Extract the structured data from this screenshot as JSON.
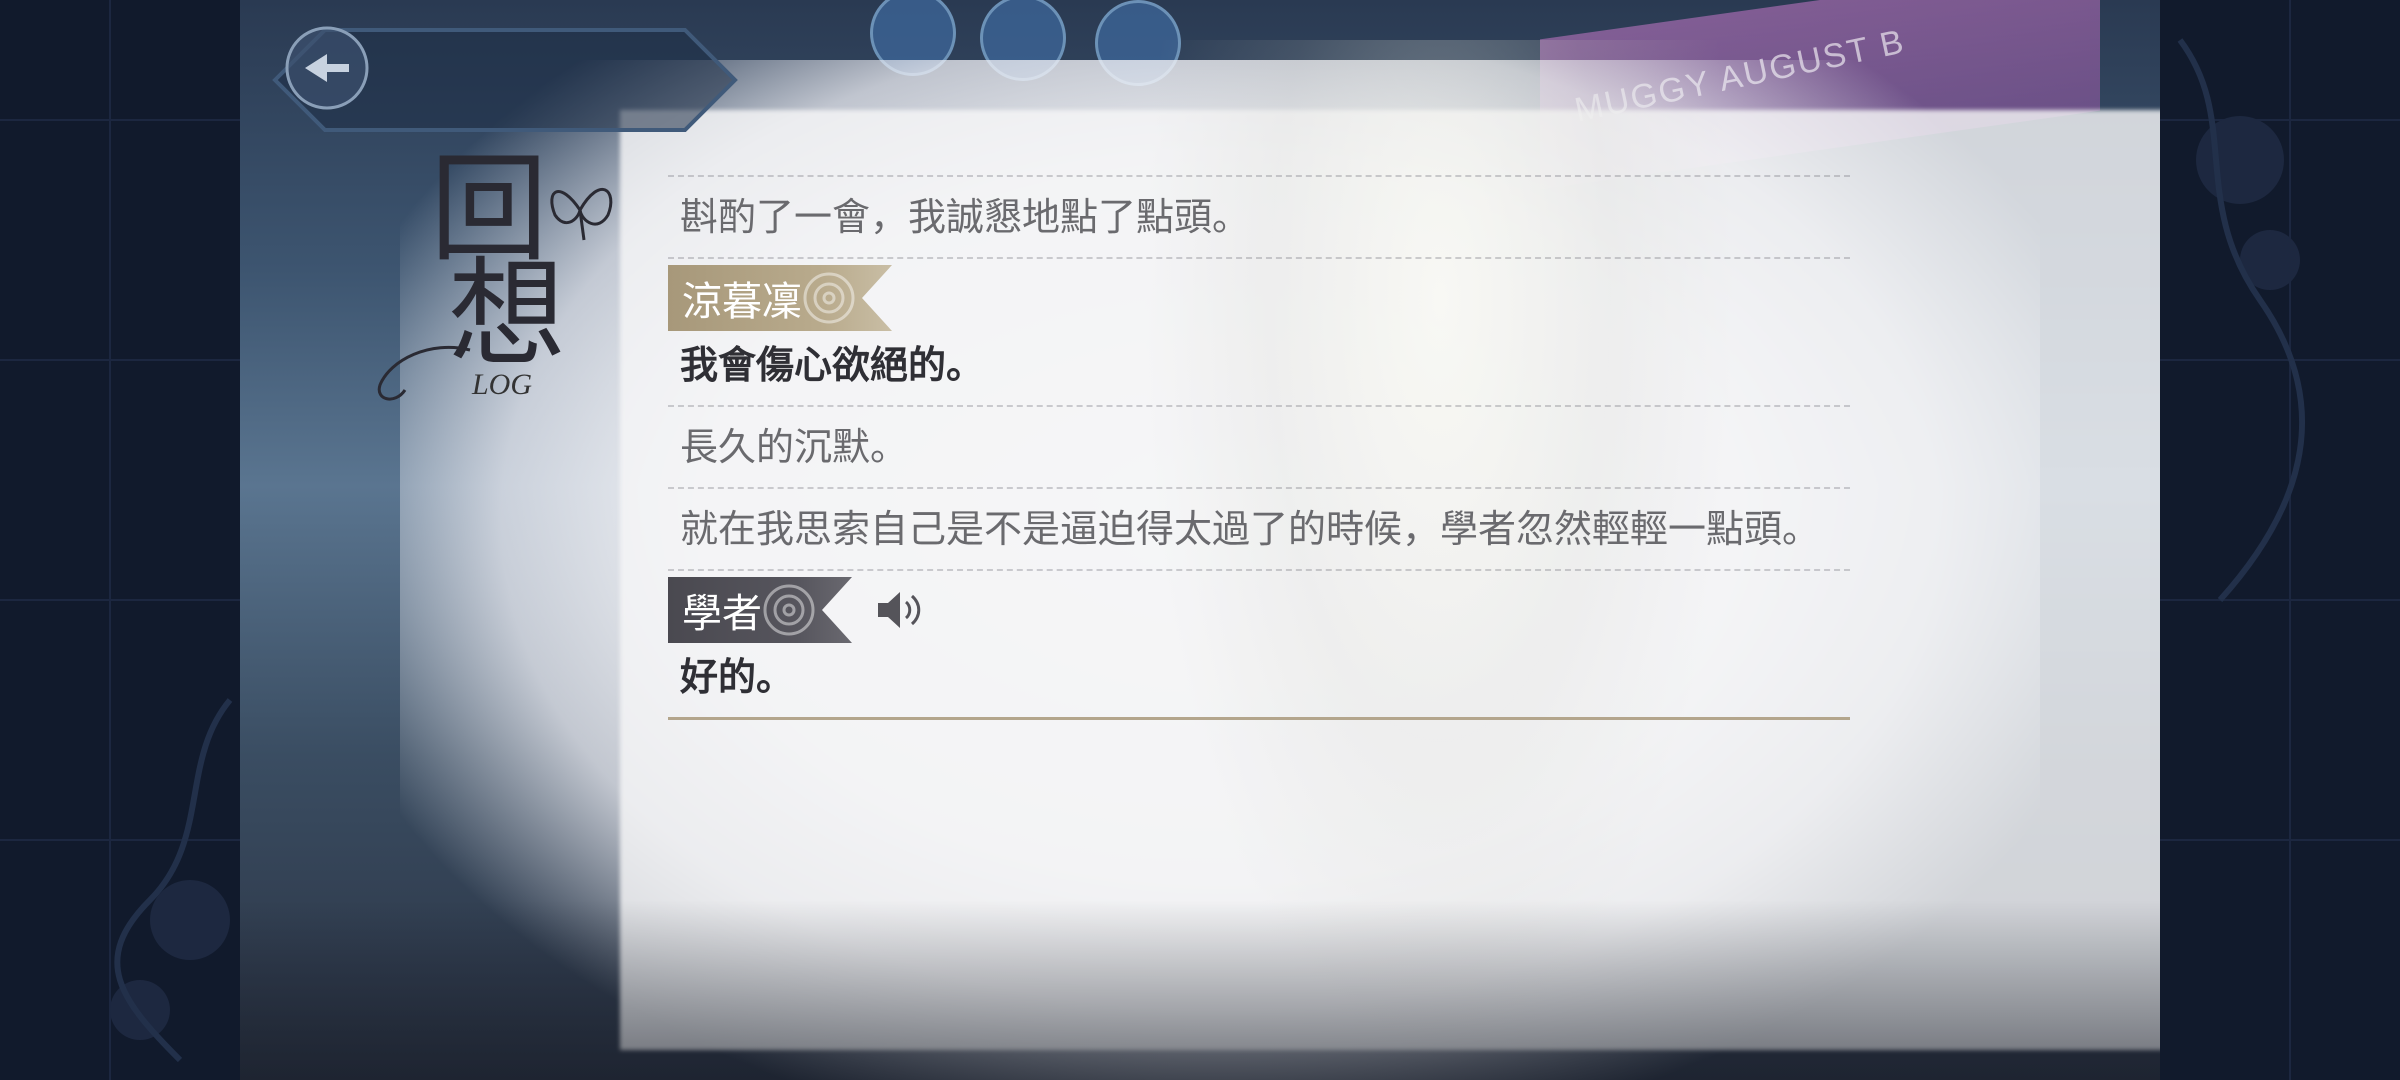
{
  "header": {
    "title_chars": [
      "回",
      "想"
    ],
    "subtitle": "LOG"
  },
  "log_entries": [
    {
      "kind": "narration",
      "text": "斟酌了一會，我誠懇地點了點頭。"
    },
    {
      "kind": "speech",
      "speaker": "涼暮凜",
      "text": "我會傷心欲絕的。",
      "tag_style": "gold",
      "has_voice": false
    },
    {
      "kind": "narration",
      "text": "長久的沉默。"
    },
    {
      "kind": "narration",
      "text": "就在我思索自己是不是逼迫得太過了的時候，學者忽然輕輕一點頭。"
    },
    {
      "kind": "speech",
      "speaker": "學者",
      "text": "好的。",
      "tag_style": "dark",
      "has_voice": true
    }
  ],
  "background_sign": "MUGGY AUGUST B",
  "colors": {
    "accent_gold": "#a7987a",
    "tag_dark": "#4a4950",
    "narration_text": "#6a6a6e",
    "speech_text": "#2f2f35"
  },
  "icons": {
    "back": "back-arrow-icon",
    "voice": "speaker-icon",
    "rose": "rose-icon",
    "butterfly": "butterfly-icon"
  }
}
